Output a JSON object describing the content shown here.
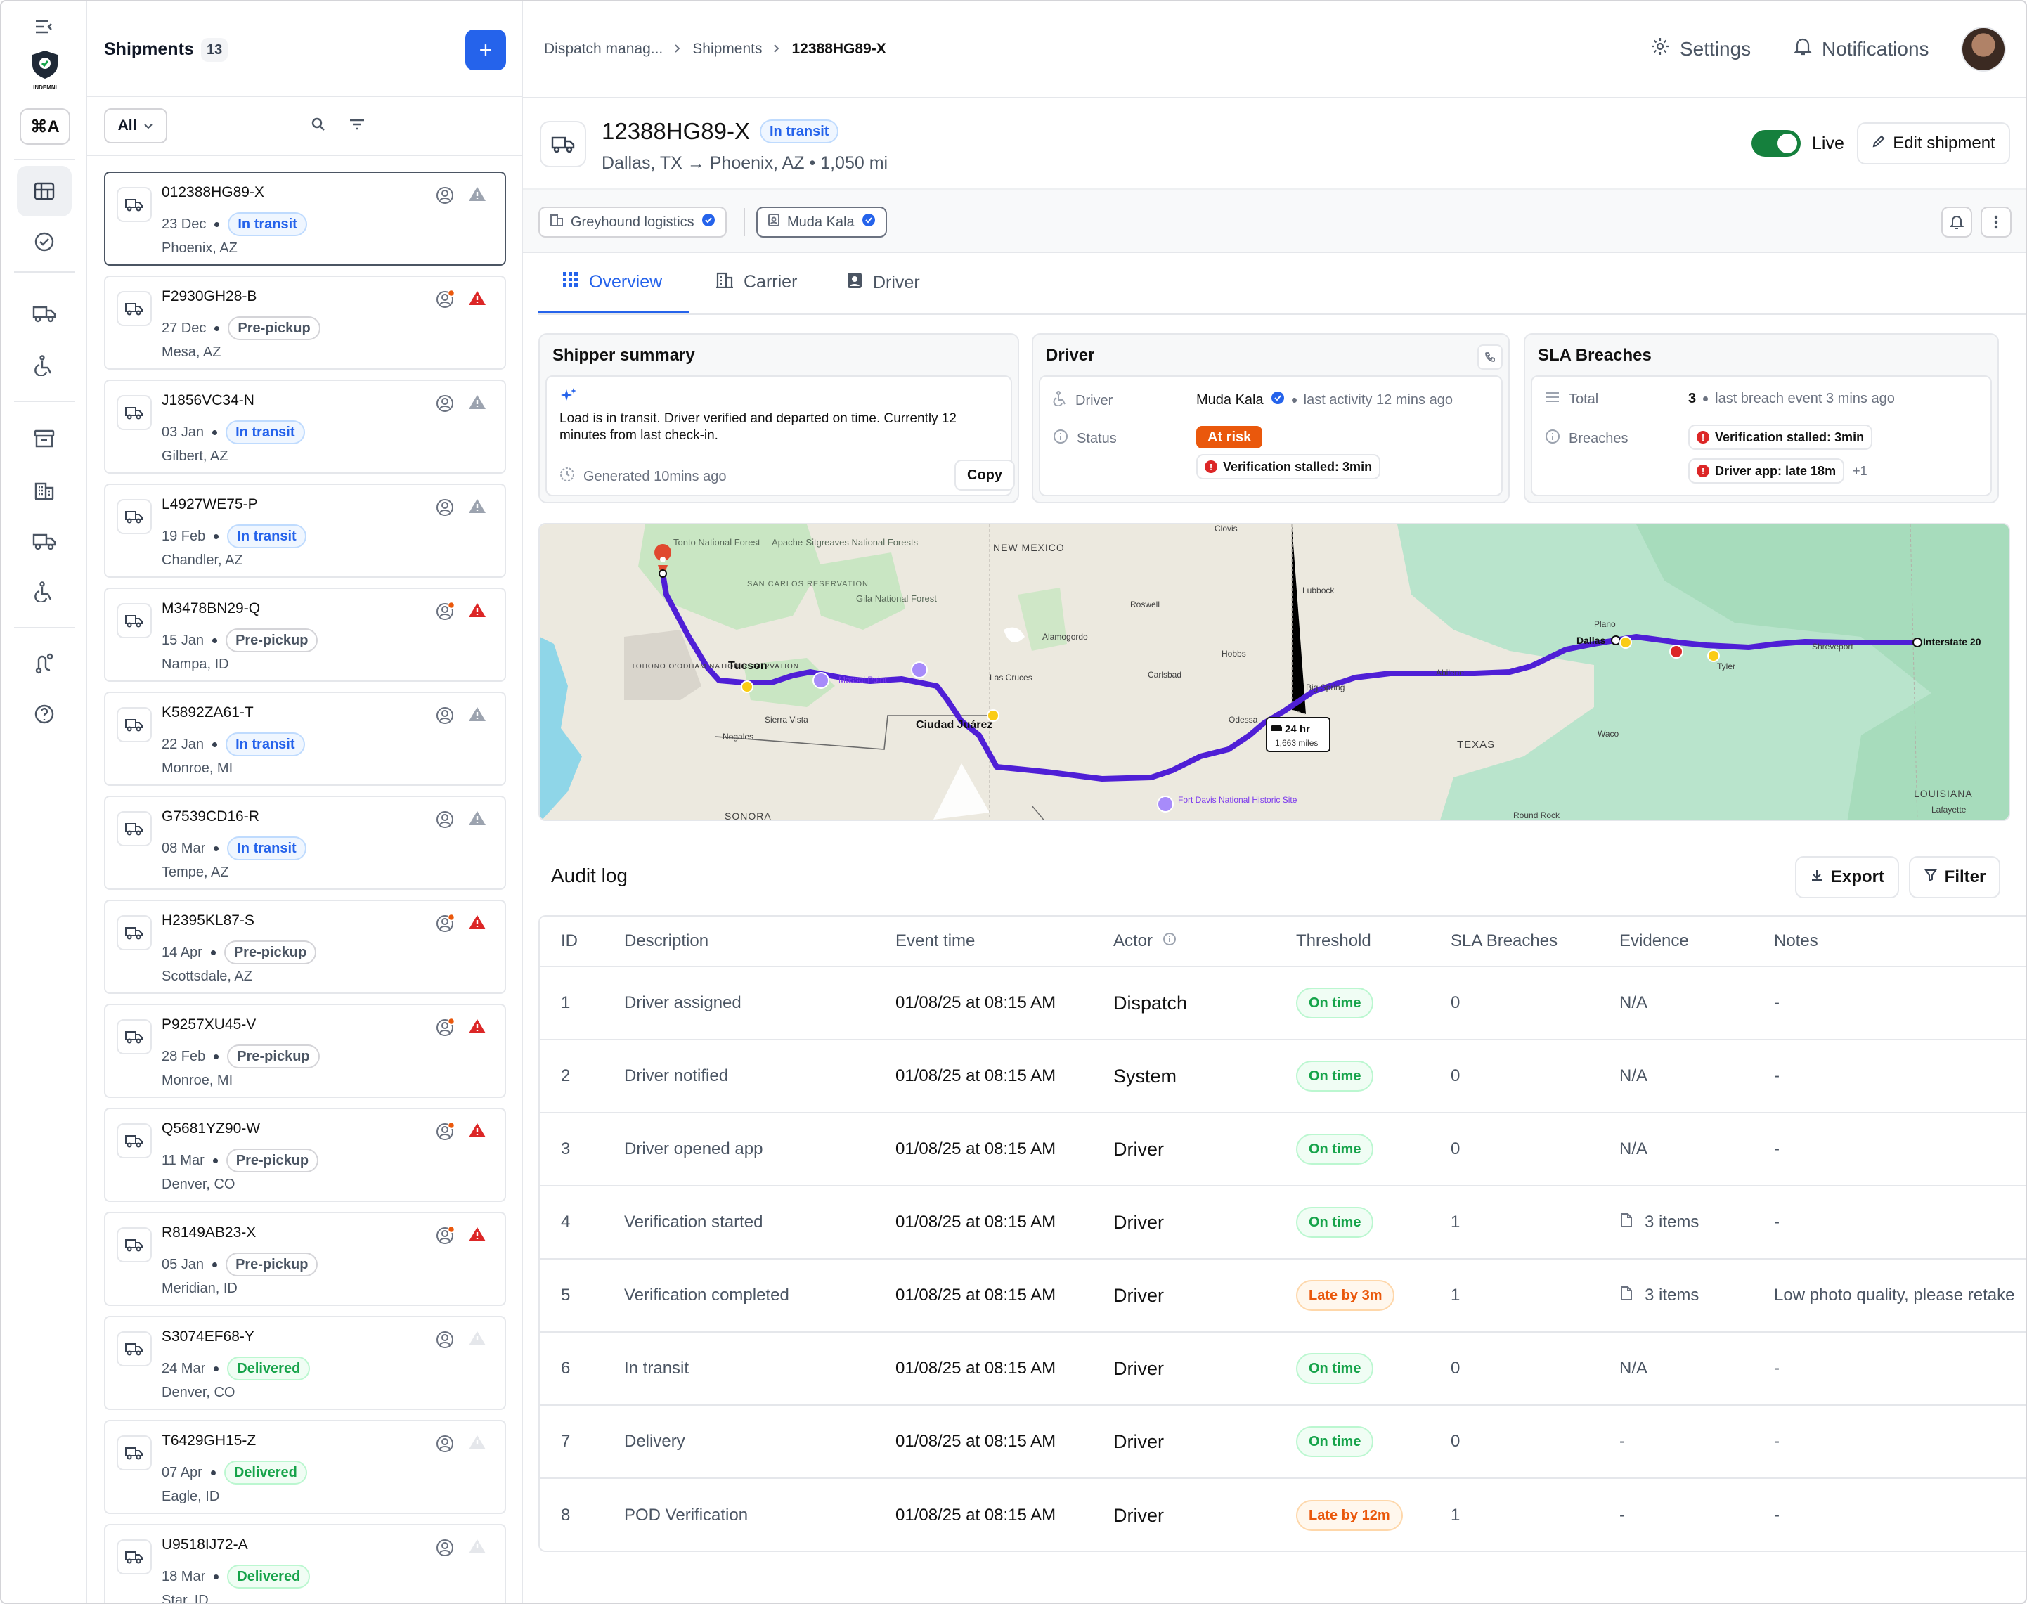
{
  "rail": {
    "kbd_label": "⌘A",
    "logo_text": "INDEMNI"
  },
  "list": {
    "title": "Shipments",
    "count": "13",
    "add_label": "+",
    "filter_label": "All",
    "items": [
      {
        "id": "012388HG89-X",
        "date": "23 Dec",
        "status": "In transit",
        "kind": "transit",
        "loc": "Phoenix, AZ",
        "alert": false,
        "selected": true
      },
      {
        "id": "F2930GH28-B",
        "date": "27 Dec",
        "status": "Pre-pickup",
        "kind": "pre",
        "loc": "Mesa, AZ",
        "alert": true
      },
      {
        "id": "J1856VC34-N",
        "date": "03 Jan",
        "status": "In transit",
        "kind": "transit",
        "loc": "Gilbert, AZ",
        "alert": false
      },
      {
        "id": "L4927WE75-P",
        "date": "19 Feb",
        "status": "In transit",
        "kind": "transit",
        "loc": "Chandler, AZ",
        "alert": false
      },
      {
        "id": "M3478BN29-Q",
        "date": "15 Jan",
        "status": "Pre-pickup",
        "kind": "pre",
        "loc": "Nampa, ID",
        "alert": true
      },
      {
        "id": "K5892ZA61-T",
        "date": "22 Jan",
        "status": "In transit",
        "kind": "transit",
        "loc": "Monroe, MI",
        "alert": false
      },
      {
        "id": "G7539CD16-R",
        "date": "08 Mar",
        "status": "In transit",
        "kind": "transit",
        "loc": "Tempe, AZ",
        "alert": false
      },
      {
        "id": "H2395KL87-S",
        "date": "14 Apr",
        "status": "Pre-pickup",
        "kind": "pre",
        "loc": "Scottsdale, AZ",
        "alert": true
      },
      {
        "id": "P9257XU45-V",
        "date": "28 Feb",
        "status": "Pre-pickup",
        "kind": "pre",
        "loc": "Monroe, MI",
        "alert": true
      },
      {
        "id": "Q5681YZ90-W",
        "date": "11 Mar",
        "status": "Pre-pickup",
        "kind": "pre",
        "loc": "Denver, CO",
        "alert": true
      },
      {
        "id": "R8149AB23-X",
        "date": "05 Jan",
        "status": "Pre-pickup",
        "kind": "pre",
        "loc": "Meridian, ID",
        "alert": true
      },
      {
        "id": "S3074EF68-Y",
        "date": "24 Mar",
        "status": "Delivered",
        "kind": "deliv",
        "loc": "Denver, CO",
        "alert": false,
        "faded": true
      },
      {
        "id": "T6429GH15-Z",
        "date": "07 Apr",
        "status": "Delivered",
        "kind": "deliv",
        "loc": "Eagle, ID",
        "alert": false,
        "faded": true
      },
      {
        "id": "U9518IJ72-A",
        "date": "18 Mar",
        "status": "Delivered",
        "kind": "deliv",
        "loc": "Star, ID",
        "alert": false,
        "faded": true
      }
    ]
  },
  "topbar": {
    "breadcrumb": [
      "Dispatch manag...",
      "Shipments",
      "12388HG89-X"
    ],
    "settings_label": "Settings",
    "notifications_label": "Notifications"
  },
  "shipment": {
    "id": "12388HG89-X",
    "status": "In transit",
    "route": "Dallas, TX → Phoenix, AZ • 1,050 mi",
    "live_label": "Live",
    "live_on": true,
    "edit_label": "Edit shipment",
    "carrier_chip": "Greyhound logistics",
    "driver_chip": "Muda Kala"
  },
  "tabs": [
    {
      "label": "Overview",
      "icon": "grid-icon",
      "active": true
    },
    {
      "label": "Carrier",
      "icon": "building-icon",
      "active": false
    },
    {
      "label": "Driver",
      "icon": "id-badge-icon",
      "active": false
    }
  ],
  "shipper_summary": {
    "title": "Shipper summary",
    "text": "Load is in transit. Driver verified and departed on time. Currently 12 minutes from last check-in.",
    "generated": "Generated 10mins ago",
    "copy_label": "Copy"
  },
  "driver_panel": {
    "title": "Driver",
    "driver_label": "Driver",
    "driver_name": "Muda Kala",
    "last_activity": "last activity 12 mins ago",
    "status_label": "Status",
    "status_value": "At risk",
    "issue": "Verification stalled: 3min"
  },
  "sla_panel": {
    "title": "SLA Breaches",
    "total_label": "Total",
    "total_value": "3",
    "last_event": "last breach event 3 mins ago",
    "breaches_label": "Breaches",
    "breach_1": "Verification stalled: 3min",
    "breach_2": "Driver app: late 18m",
    "more": "+1"
  },
  "map": {
    "labels": {
      "tonto": "Tonto National Forest",
      "apache": "Apache-Sitgreaves National Forests",
      "sancarlos": "SAN CARLOS RESERVATION",
      "gila": "Gila National Forest",
      "newmexico": "NEW MEXICO",
      "clovis": "Clovis",
      "lubbock": "Lubbock",
      "roswell": "Roswell",
      "alamogordo": "Alamogordo",
      "hobbs": "Hobbs",
      "carlsbad": "Carlsbad",
      "tucson": "Tucson",
      "tohono": "TOHONO O'ODHAM NATION RESERVATION",
      "massai": "Massai Point",
      "lascruces": "Las Cruces",
      "sierravista": "Sierra Vista",
      "nogales": "Nogales",
      "juarez": "Ciudad Juárez",
      "odessa": "Odessa",
      "bigspring": "Big Spring",
      "abilene": "Abilene",
      "plano": "Plano",
      "dallas": "Dallas",
      "tyler": "Tyler",
      "shreveport": "Shreveport",
      "interstate": "Interstate 20",
      "texas": "TEXAS",
      "waco": "Waco",
      "fortdavis": "Fort Davis National Historic Site",
      "sonora": "SONORA",
      "roundrock": "Round Rock",
      "louisiana": "LOUISIANA",
      "lafayette": "Lafayette",
      "eta_time": "24 hr",
      "eta_dist": "1,663 miles"
    }
  },
  "audit": {
    "title": "Audit log",
    "export_label": "Export",
    "filter_label": "Filter",
    "columns": [
      "ID",
      "Description",
      "Event time",
      "Actor",
      "Threshold",
      "SLA Breaches",
      "Evidence",
      "Notes"
    ],
    "rows": [
      {
        "id": "1",
        "desc": "Driver assigned",
        "time": "01/08/25 at 08:15 AM",
        "actor": "Dispatch",
        "threshold": "On time",
        "t_kind": "ok",
        "sla": "0",
        "evidence": "N/A",
        "ev_file": false,
        "notes": "-"
      },
      {
        "id": "2",
        "desc": "Driver notified",
        "time": "01/08/25 at 08:15 AM",
        "actor": "System",
        "threshold": "On time",
        "t_kind": "ok",
        "sla": "0",
        "evidence": "N/A",
        "ev_file": false,
        "notes": "-"
      },
      {
        "id": "3",
        "desc": "Driver opened app",
        "time": "01/08/25 at 08:15 AM",
        "actor": "Driver",
        "threshold": "On time",
        "t_kind": "ok",
        "sla": "0",
        "evidence": "N/A",
        "ev_file": false,
        "notes": "-"
      },
      {
        "id": "4",
        "desc": "Verification started",
        "time": "01/08/25 at 08:15 AM",
        "actor": "Driver",
        "threshold": "On time",
        "t_kind": "ok",
        "sla": "1",
        "evidence": "3 items",
        "ev_file": true,
        "notes": "-"
      },
      {
        "id": "5",
        "desc": "Verification completed",
        "time": "01/08/25 at 08:15 AM",
        "actor": "Driver",
        "threshold": "Late by 3m",
        "t_kind": "late",
        "sla": "1",
        "evidence": "3 items",
        "ev_file": true,
        "notes": "Low photo quality, please retake"
      },
      {
        "id": "6",
        "desc": "In transit",
        "time": "01/08/25 at 08:15 AM",
        "actor": "Driver",
        "threshold": "On time",
        "t_kind": "ok",
        "sla": "0",
        "evidence": "N/A",
        "ev_file": false,
        "notes": "-"
      },
      {
        "id": "7",
        "desc": "Delivery",
        "time": "01/08/25 at 08:15 AM",
        "actor": "Driver",
        "threshold": "On time",
        "t_kind": "ok",
        "sla": "0",
        "evidence": "-",
        "ev_file": false,
        "notes": "-"
      },
      {
        "id": "8",
        "desc": "POD Verification",
        "time": "01/08/25 at 08:15 AM",
        "actor": "Driver",
        "threshold": "Late by 12m",
        "t_kind": "late",
        "sla": "1",
        "evidence": "-",
        "ev_file": false,
        "notes": "-"
      }
    ]
  },
  "colors": {
    "accent": "#2563eb",
    "route": "#4f1fd6",
    "danger": "#dc2626",
    "warning": "#ea580c",
    "success": "#16a34a"
  }
}
